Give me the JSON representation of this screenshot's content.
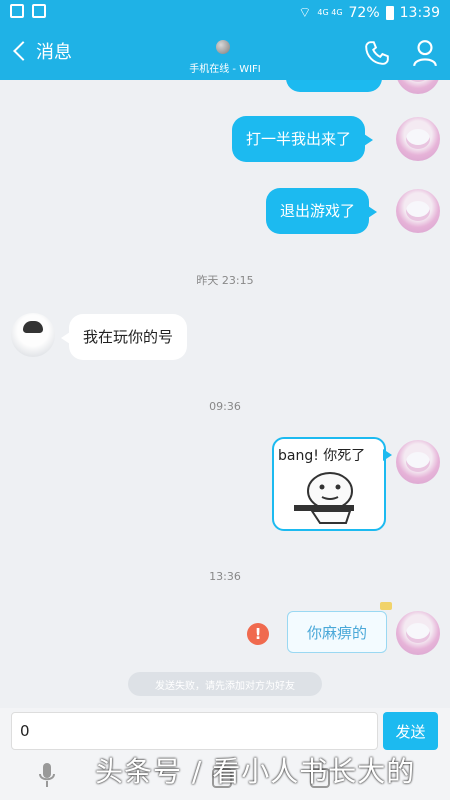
{
  "status_bar": {
    "network": "4G 4G",
    "battery": "72%",
    "time": "13:39"
  },
  "header": {
    "back_label": "消息",
    "online_status": "手机在线 - WIFI",
    "accent_color": "#1fb2e6"
  },
  "messages": [
    {
      "type": "text",
      "side": "right",
      "text": "打一半我出来了"
    },
    {
      "type": "text",
      "side": "right",
      "text": "退出游戏了"
    },
    {
      "type": "timestamp",
      "text": "昨天 23:15"
    },
    {
      "type": "text",
      "side": "left",
      "text": "我在玩你的号"
    },
    {
      "type": "timestamp",
      "text": "09:36"
    },
    {
      "type": "sticker",
      "side": "right",
      "text": "bang! 你死了"
    },
    {
      "type": "timestamp",
      "text": "13:36"
    },
    {
      "type": "fancy",
      "side": "right",
      "text": "你麻痹的",
      "status": "failed"
    }
  ],
  "system_notice": "发送失败，请先添加对方为好友",
  "input": {
    "value": "0",
    "send_label": "发送"
  },
  "watermark": "头条号 / 看小人书长大的"
}
